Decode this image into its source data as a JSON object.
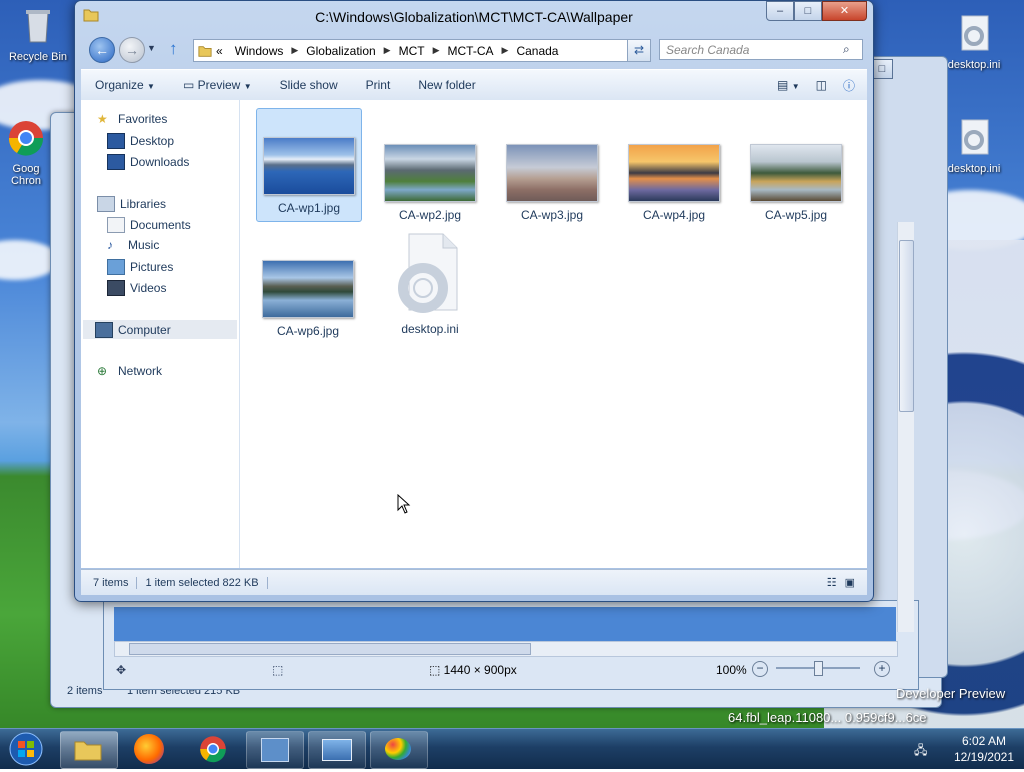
{
  "window": {
    "title": "C:\\Windows\\Globalization\\MCT\\MCT-CA\\Wallpaper"
  },
  "address": {
    "overflow": "«",
    "crumbs": [
      "Windows",
      "Globalization",
      "MCT",
      "MCT-CA",
      "Canada"
    ]
  },
  "search": {
    "placeholder": "Search Canada"
  },
  "toolbar": {
    "organize": "Organize",
    "preview": "Preview",
    "slideshow": "Slide show",
    "print": "Print",
    "new_folder": "New folder"
  },
  "nav": {
    "favorites": "Favorites",
    "desktop": "Desktop",
    "downloads": "Downloads",
    "libraries": "Libraries",
    "documents": "Documents",
    "music": "Music",
    "pictures": "Pictures",
    "videos": "Videos",
    "computer": "Computer",
    "network": "Network"
  },
  "files": [
    {
      "name": "CA-wp1.jpg",
      "selected": true
    },
    {
      "name": "CA-wp2.jpg"
    },
    {
      "name": "CA-wp3.jpg"
    },
    {
      "name": "CA-wp4.jpg"
    },
    {
      "name": "CA-wp5.jpg"
    },
    {
      "name": "CA-wp6.jpg"
    },
    {
      "name": "desktop.ini"
    }
  ],
  "status": {
    "count": "7 items",
    "selection": "1 item selected  822 KB"
  },
  "desktop_icons": {
    "recycle": "Recycle Bin",
    "chrome": "Goog\nChron",
    "desktop_ini_1": "desktop.ini",
    "desktop_ini_2": "desktop.ini"
  },
  "viewer": {
    "dimensions": "1440 × 900px",
    "zoom": "100%"
  },
  "background_window": {
    "count": "2 items",
    "selection": "1 item selected  215 KB"
  },
  "watermark": {
    "line1": "Developer Preview",
    "line2": "64.fbl_leap.11080... 0.959cf9...6ce"
  },
  "clock": {
    "time": "6:02 AM",
    "date": "12/19/2021"
  }
}
